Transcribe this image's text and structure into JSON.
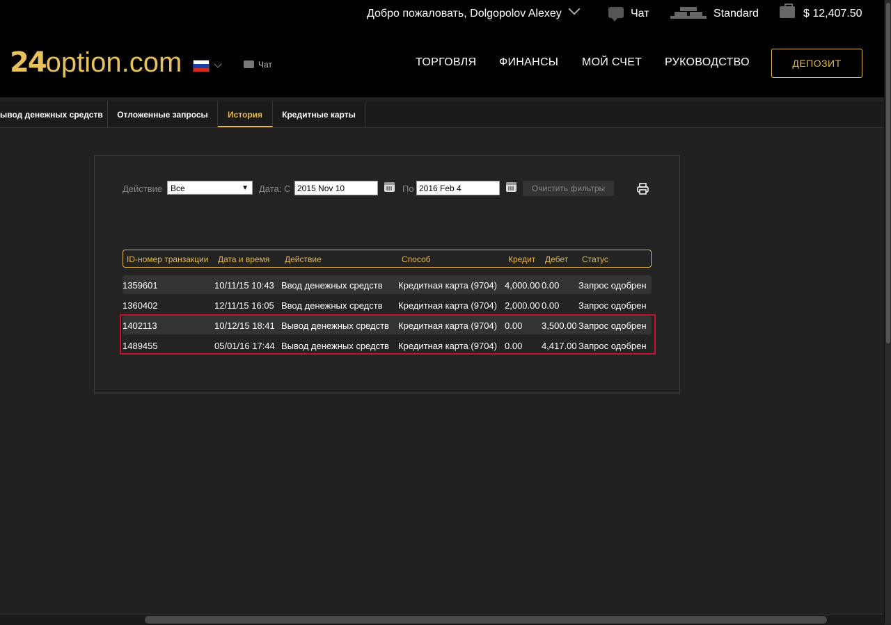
{
  "topbar": {
    "welcome": "Добро пожаловать, Dolgopolov Alexey",
    "chat_label": "Чат",
    "account_tier": "Standard",
    "balance": "$ 12,407.50"
  },
  "header": {
    "logo_number": "24",
    "logo_name": "option.com",
    "language_flag": "ru",
    "chat_label": "Чат",
    "nav": [
      "ТОРГОВЛЯ",
      "ФИНАНСЫ",
      "МОЙ СЧЕТ",
      "РУКОВОДСТВО"
    ],
    "deposit_label": "ДЕПОЗИТ"
  },
  "subtabs": {
    "items": [
      {
        "label": "ывод денежных средств"
      },
      {
        "label": "Отложенные запросы"
      },
      {
        "label": "История",
        "active": true
      },
      {
        "label": "Кредитные карты"
      }
    ]
  },
  "filters": {
    "action_label": "Действие",
    "action_value": "Все",
    "date_from_label": "Дата: С",
    "date_from_value": "2015 Nov 10",
    "date_to_label": "По",
    "date_to_value": "2016 Feb 4",
    "clear_label": "Очистить фильтры"
  },
  "table": {
    "headers": [
      "ID-номер транзакции",
      "Дата и время",
      "Действие",
      "Способ",
      "Кредит",
      "Дебет",
      "Статус"
    ],
    "rows": [
      {
        "id": "1359601",
        "datetime": "10/11/15 10:43",
        "action": "Ввод денежных средств",
        "method": "Кредитная карта (9704)",
        "credit": "4,000.00",
        "debit": "0.00",
        "status": "Запрос одобрен"
      },
      {
        "id": "1360402",
        "datetime": "12/11/15 16:05",
        "action": "Ввод денежных средств",
        "method": "Кредитная карта (9704)",
        "credit": "2,000.00",
        "debit": "0.00",
        "status": "Запрос одобрен"
      },
      {
        "id": "1402113",
        "datetime": "10/12/15 18:41",
        "action": "Вывод денежных средств",
        "method": "Кредитная карта (9704)",
        "credit": "0.00",
        "debit": "3,500.00",
        "status": "Запрос одобрен"
      },
      {
        "id": "1489455",
        "datetime": "05/01/16 17:44",
        "action": "Вывод денежных средств",
        "method": "Кредитная карта (9704)",
        "credit": "0.00",
        "debit": "4,417.00",
        "status": "Запрос одобрен"
      }
    ]
  },
  "colors": {
    "accent": "#e6b84a",
    "highlight": "#c8102e",
    "background": "#212121"
  }
}
